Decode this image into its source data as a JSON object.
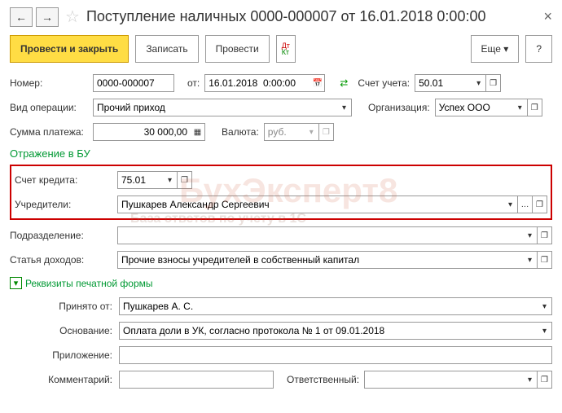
{
  "header": {
    "title": "Поступление наличных 0000-000007 от 16.01.2018 0:00:00"
  },
  "toolbar": {
    "postClose": "Провести и закрыть",
    "write": "Записать",
    "post": "Провести",
    "more": "Еще",
    "help": "?"
  },
  "f": {
    "numLbl": "Номер:",
    "num": "0000-000007",
    "fromLbl": "от:",
    "date": "16.01.2018  0:00:00",
    "acctLbl": "Счет учета:",
    "acct": "50.01",
    "opLbl": "Вид операции:",
    "op": "Прочий приход",
    "orgLbl": "Организация:",
    "org": "Успех ООО",
    "sumLbl": "Сумма платежа:",
    "sum": "30 000,00",
    "curLbl": "Валюта:",
    "cur": "руб.",
    "sectBU": "Отражение в БУ",
    "credLbl": "Счет кредита:",
    "cred": "75.01",
    "fndLbl": "Учредители:",
    "fnd": "Пушкарев Александр Сергеевич",
    "divLbl": "Подразделение:",
    "div": "",
    "incLbl": "Статья доходов:",
    "inc": "Прочие взносы учредителей в собственный капитал",
    "printChk": "Реквизиты печатной формы",
    "recvLbl": "Принято от:",
    "recv": "Пушкарев А. С.",
    "baseLbl": "Основание:",
    "base": "Оплата доли в УК, согласно протокола № 1 от 09.01.2018",
    "attLbl": "Приложение:",
    "att": "",
    "comLbl": "Комментарий:",
    "com": "",
    "respLbl": "Ответственный:",
    "resp": ""
  }
}
